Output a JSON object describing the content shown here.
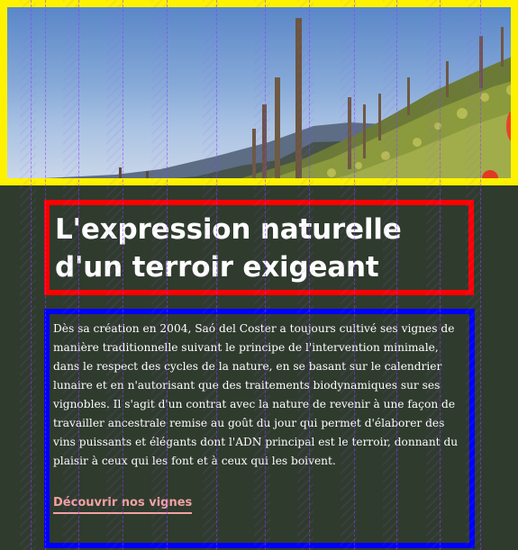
{
  "hero": {
    "image_alt_icon": "vineyard-photo"
  },
  "heading": {
    "line1": "L'expression naturelle",
    "line2": "d'un terroir exigeant"
  },
  "intro": {
    "paragraph": "Dès sa création en 2004, Saó del Coster a toujours cultivé ses vignes de manière traditionnelle suivant le principe de l'intervention minimale, dans le respect des cycles de la nature, en se basant sur le calendrier lunaire et en n'autorisant que des traitements biodynamiques sur ses vignobles. Il s'agit d'un contrat avec la nature de revenir à une façon de travailler ancestrale remise au goût du jour qui permet d'élaborer des vins puissants et élégants dont l'ADN principal est le terroir, donnant du plaisir à ceux qui les font et à ceux qui les boivent.",
    "cta_label": "Découvrir nos vignes"
  },
  "colors": {
    "background": "#2f3b2d",
    "cta": "#f2a1a1",
    "hero_outline": "#fff200",
    "heading_outline": "#ff0000",
    "body_outline": "#0000ff"
  }
}
